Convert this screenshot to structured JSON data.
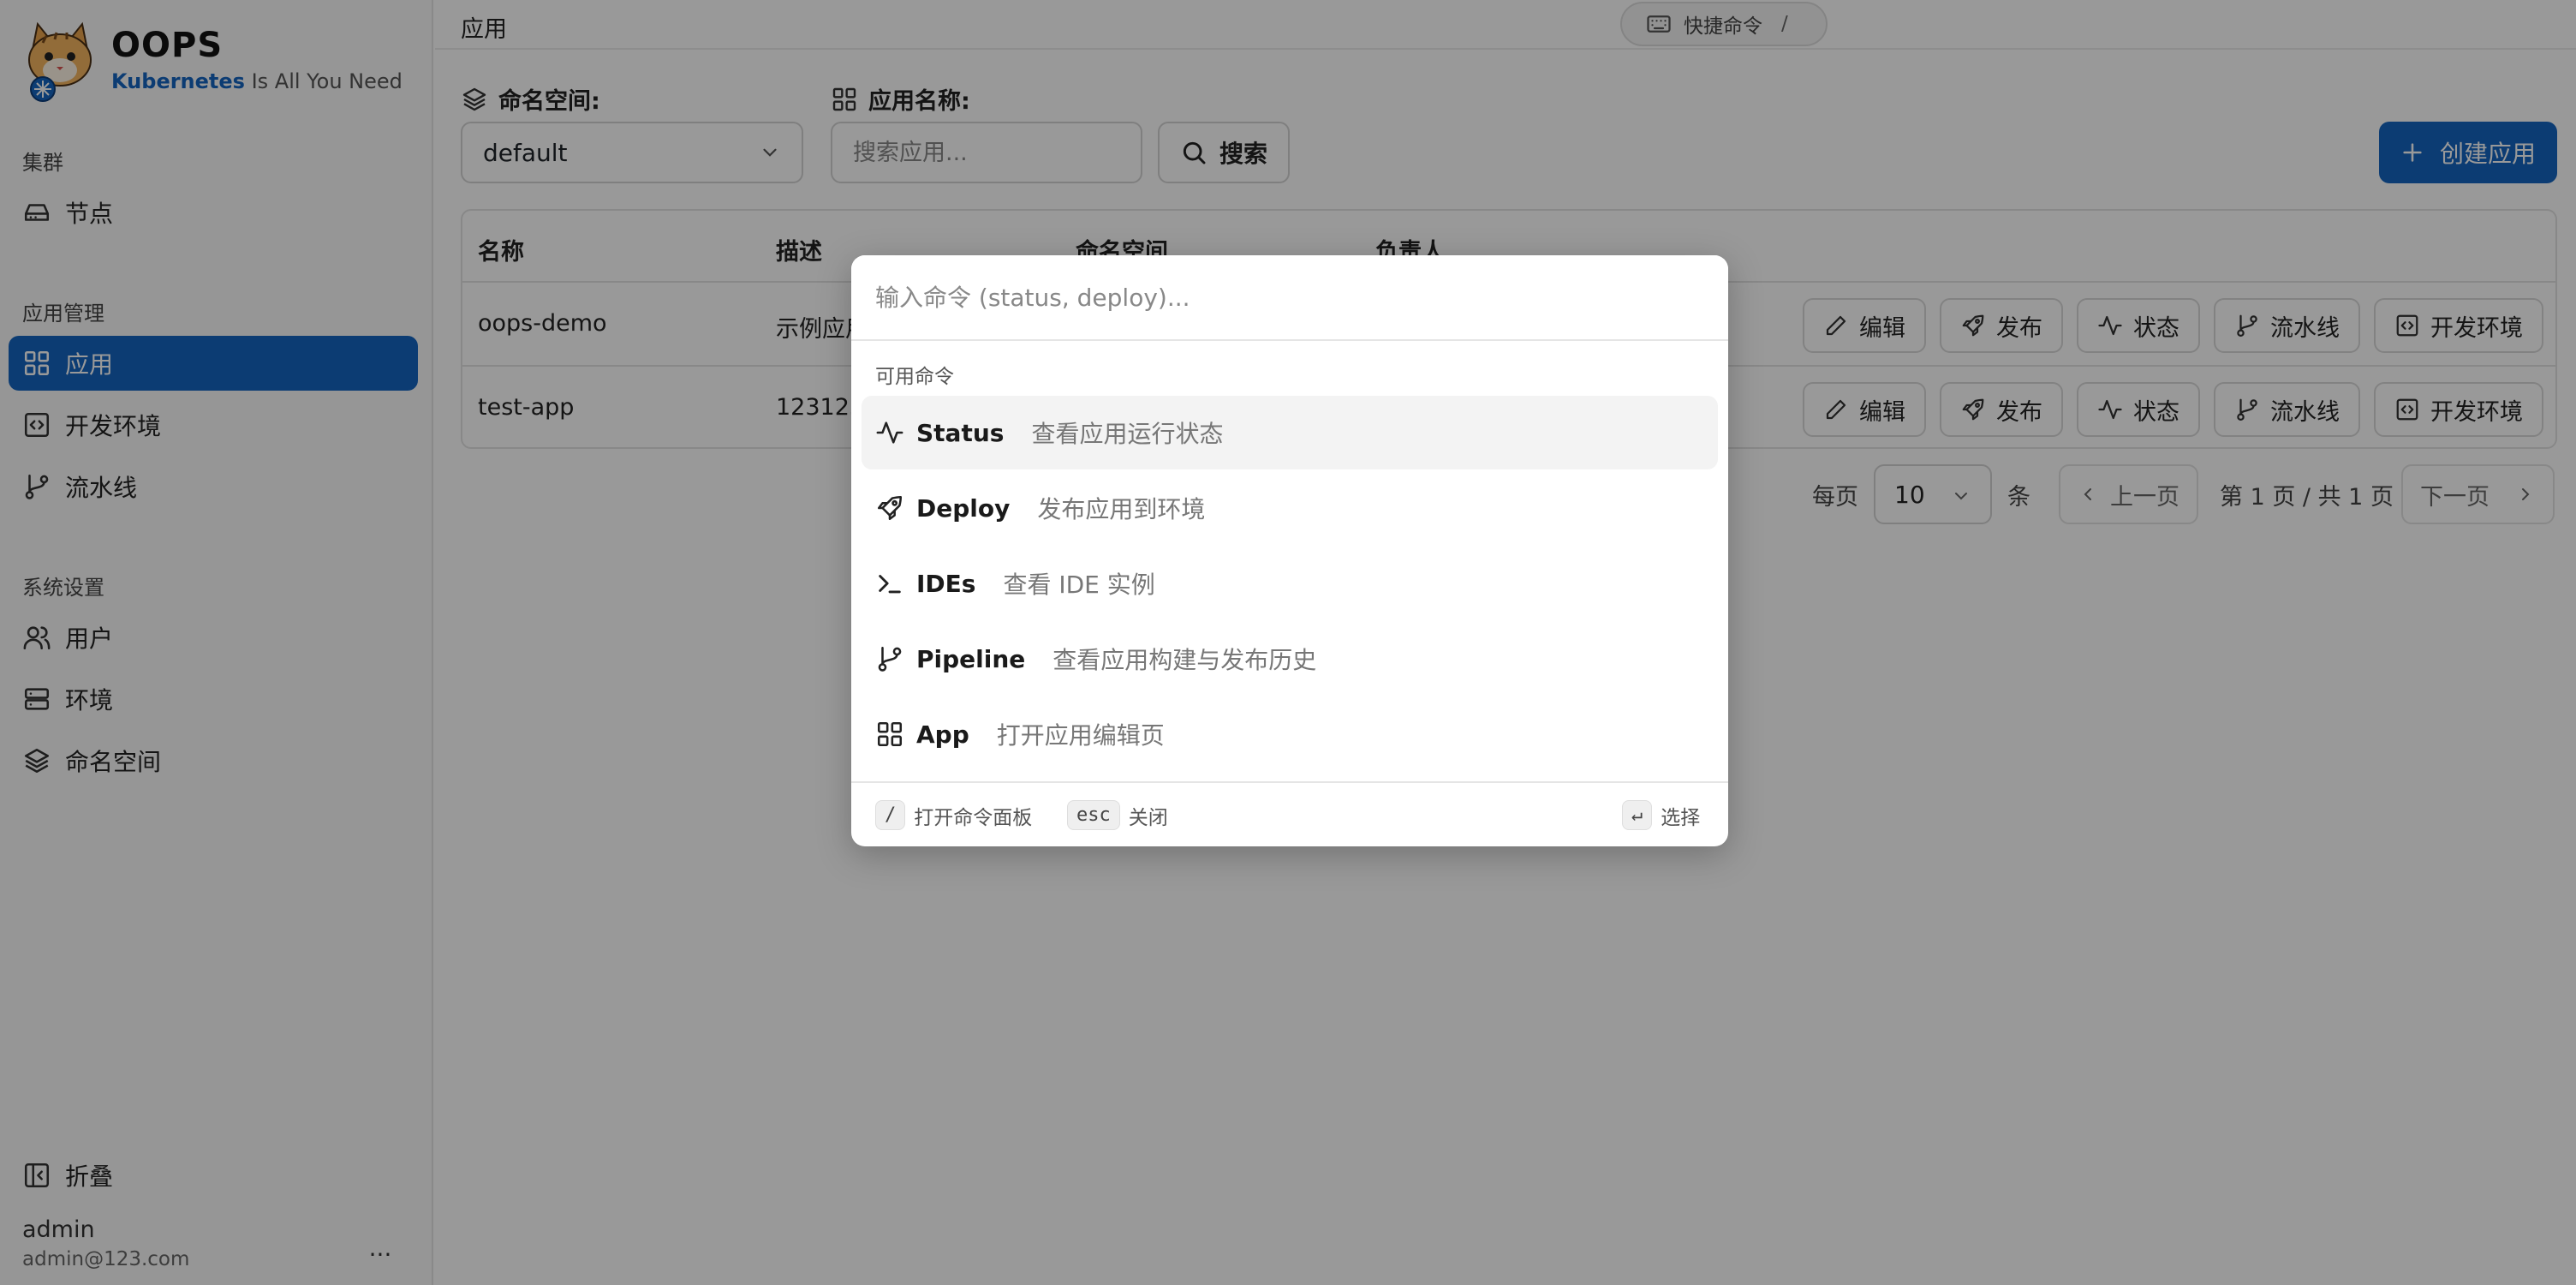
{
  "brand": {
    "title": "OOPS",
    "sub_accent": "Kubernetes",
    "sub_rest": " Is All You Need"
  },
  "sidebar": {
    "groups": [
      {
        "title": "集群",
        "items": [
          {
            "label": "节点",
            "icon": "server-icon"
          }
        ]
      },
      {
        "title": "应用管理",
        "items": [
          {
            "label": "应用",
            "icon": "apps-grid-icon",
            "active": true
          },
          {
            "label": "开发环境",
            "icon": "code-box-icon"
          },
          {
            "label": "流水线",
            "icon": "git-branch-icon"
          }
        ]
      },
      {
        "title": "系统设置",
        "items": [
          {
            "label": "用户",
            "icon": "users-icon"
          },
          {
            "label": "环境",
            "icon": "server-stack-icon"
          },
          {
            "label": "命名空间",
            "icon": "layers-icon"
          }
        ]
      }
    ],
    "collapse_label": "折叠",
    "user": {
      "name": "admin",
      "email": "admin@123.com"
    },
    "more_label": "..."
  },
  "topbar": {
    "title": "应用",
    "quick_command_label": "快捷命令",
    "quick_command_key": "/"
  },
  "filters": {
    "namespace_label": "命名空间:",
    "namespace_value": "default",
    "app_name_label": "应用名称:",
    "search_placeholder": "搜索应用...",
    "search_button": "搜索",
    "create_button": "创建应用"
  },
  "table": {
    "columns": [
      "名称",
      "描述",
      "命名空间",
      "负责人"
    ],
    "rows": [
      {
        "name": "oops-demo",
        "desc": "示例应用"
      },
      {
        "name": "test-app",
        "desc": "123123"
      }
    ],
    "actions": [
      "编辑",
      "发布",
      "状态",
      "流水线",
      "开发环境"
    ]
  },
  "pagination": {
    "per_page_label": "每页",
    "per_page_value": "10",
    "per_page_unit": "条",
    "prev": "上一页",
    "page_info": "第 1 页 / 共 1 页",
    "next": "下一页"
  },
  "palette": {
    "placeholder": "输入命令 (status, deploy)...",
    "group_title": "可用命令",
    "commands": [
      {
        "name": "Status",
        "desc": "查看应用运行状态",
        "icon": "activity-icon"
      },
      {
        "name": "Deploy",
        "desc": "发布应用到环境",
        "icon": "rocket-icon"
      },
      {
        "name": "IDEs",
        "desc": "查看 IDE 实例",
        "icon": "terminal-icon"
      },
      {
        "name": "Pipeline",
        "desc": "查看应用构建与发布历史",
        "icon": "git-branch-icon"
      },
      {
        "name": "App",
        "desc": "打开应用编辑页",
        "icon": "apps-grid-icon"
      }
    ],
    "footer": {
      "open_key": "/",
      "open_label": "打开命令面板",
      "close_key": "esc",
      "close_label": "关闭",
      "select_key": "↵",
      "select_label": "选择"
    }
  },
  "colors": {
    "primary": "#1565c0",
    "overlay": "rgba(0,0,0,0.40)"
  }
}
